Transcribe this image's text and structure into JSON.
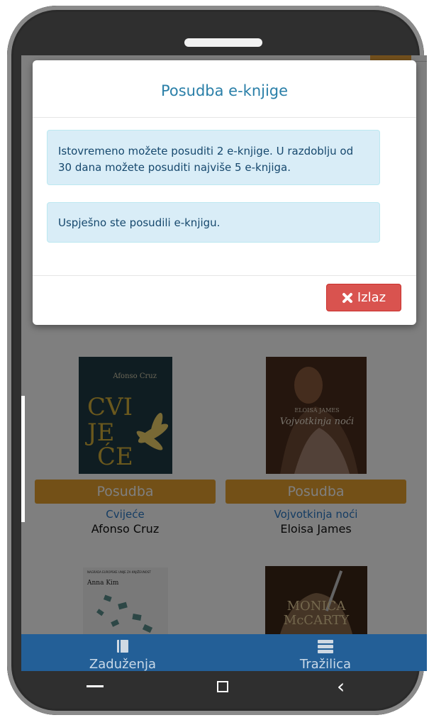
{
  "modal": {
    "title": "Posudba e-knjige",
    "alert_limit": "Istovremeno možete posuditi 2 e-knjige. U razdoblju od 30 dana možete posuditi najviše 5 e-knjiga.",
    "alert_success": "Uspješno ste posudili e-knjigu.",
    "exit_icon": "times-icon",
    "exit_label": "Izlaz"
  },
  "books": [
    {
      "cover": {
        "title_text": "CVIJEĆE",
        "author_text": "Afonso Cruz",
        "color": "#1f3a44"
      },
      "button_label": "Posudba",
      "title": "Cvijeće",
      "author": "Afonso Cruz"
    },
    {
      "cover": {
        "title_text": "Vojvotkinja noći",
        "author_text": "ELOISA JAMES",
        "color": "#4b2c1c"
      },
      "button_label": "Posudba",
      "title": "Vojvotkinja noći",
      "author": "Eloisa James"
    },
    {
      "cover": {
        "author_text": "Anna Kim",
        "top_text": "NAGRADA EUROPSKE UNIJE ZA KNJIŽEVNOST",
        "color": "#f3f3f3"
      }
    },
    {
      "cover": {
        "title_text": "MONICA McCARTY",
        "color": "#3d2617"
      }
    }
  ],
  "bottom_nav": [
    {
      "icon": "book-icon",
      "label": "Zaduženja"
    },
    {
      "icon": "server-list-icon",
      "label": "Tražilica"
    }
  ],
  "colors": {
    "borrow_button": "#e6a02e",
    "modal_title": "#2a7fa8",
    "alert_bg": "#d9edf7",
    "exit_button": "#d9534f",
    "bottom_nav": "#235f97"
  }
}
